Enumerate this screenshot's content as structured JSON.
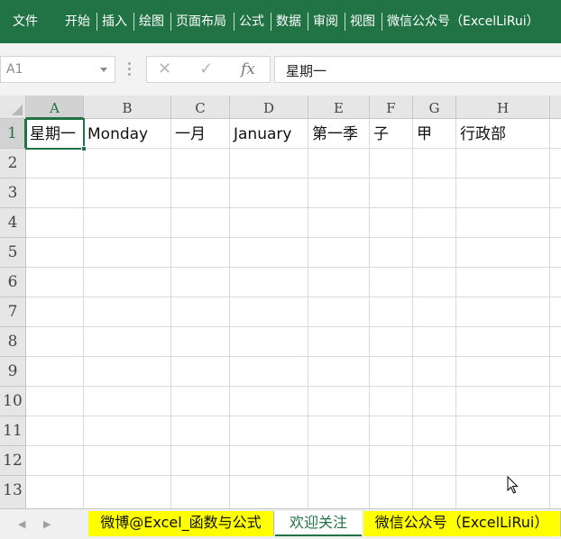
{
  "ribbon": {
    "tabs": [
      "文件",
      "开始",
      "插入",
      "绘图",
      "页面布局",
      "公式",
      "数据",
      "审阅",
      "视图",
      "微信公众号（ExcelLiRui）"
    ]
  },
  "formula_bar": {
    "name_box": "A1",
    "cancel_icon": "✕",
    "enter_icon": "✓",
    "function_icon": "fx",
    "content": "星期一"
  },
  "grid": {
    "columns": [
      "A",
      "B",
      "C",
      "D",
      "E",
      "F",
      "G",
      "H"
    ],
    "rows": [
      "1",
      "2",
      "3",
      "4",
      "5",
      "6",
      "7",
      "8",
      "9",
      "10",
      "11",
      "12",
      "13"
    ],
    "row1": [
      "星期一",
      "Monday",
      "一月",
      "January",
      "第一季",
      "子",
      "甲",
      "行政部"
    ],
    "active_cell": "A1"
  },
  "sheet_tabs": {
    "nav_prev": "◀",
    "nav_next": "▶",
    "tabs": [
      "微博@Excel_函数与公式",
      "欢迎关注",
      "微信公众号（ExcelLiRui）"
    ],
    "active": "欢迎关注"
  },
  "colors": {
    "ribbon": "#217346",
    "highlight_tab": "#ffff00",
    "active_accent": "#217346"
  }
}
